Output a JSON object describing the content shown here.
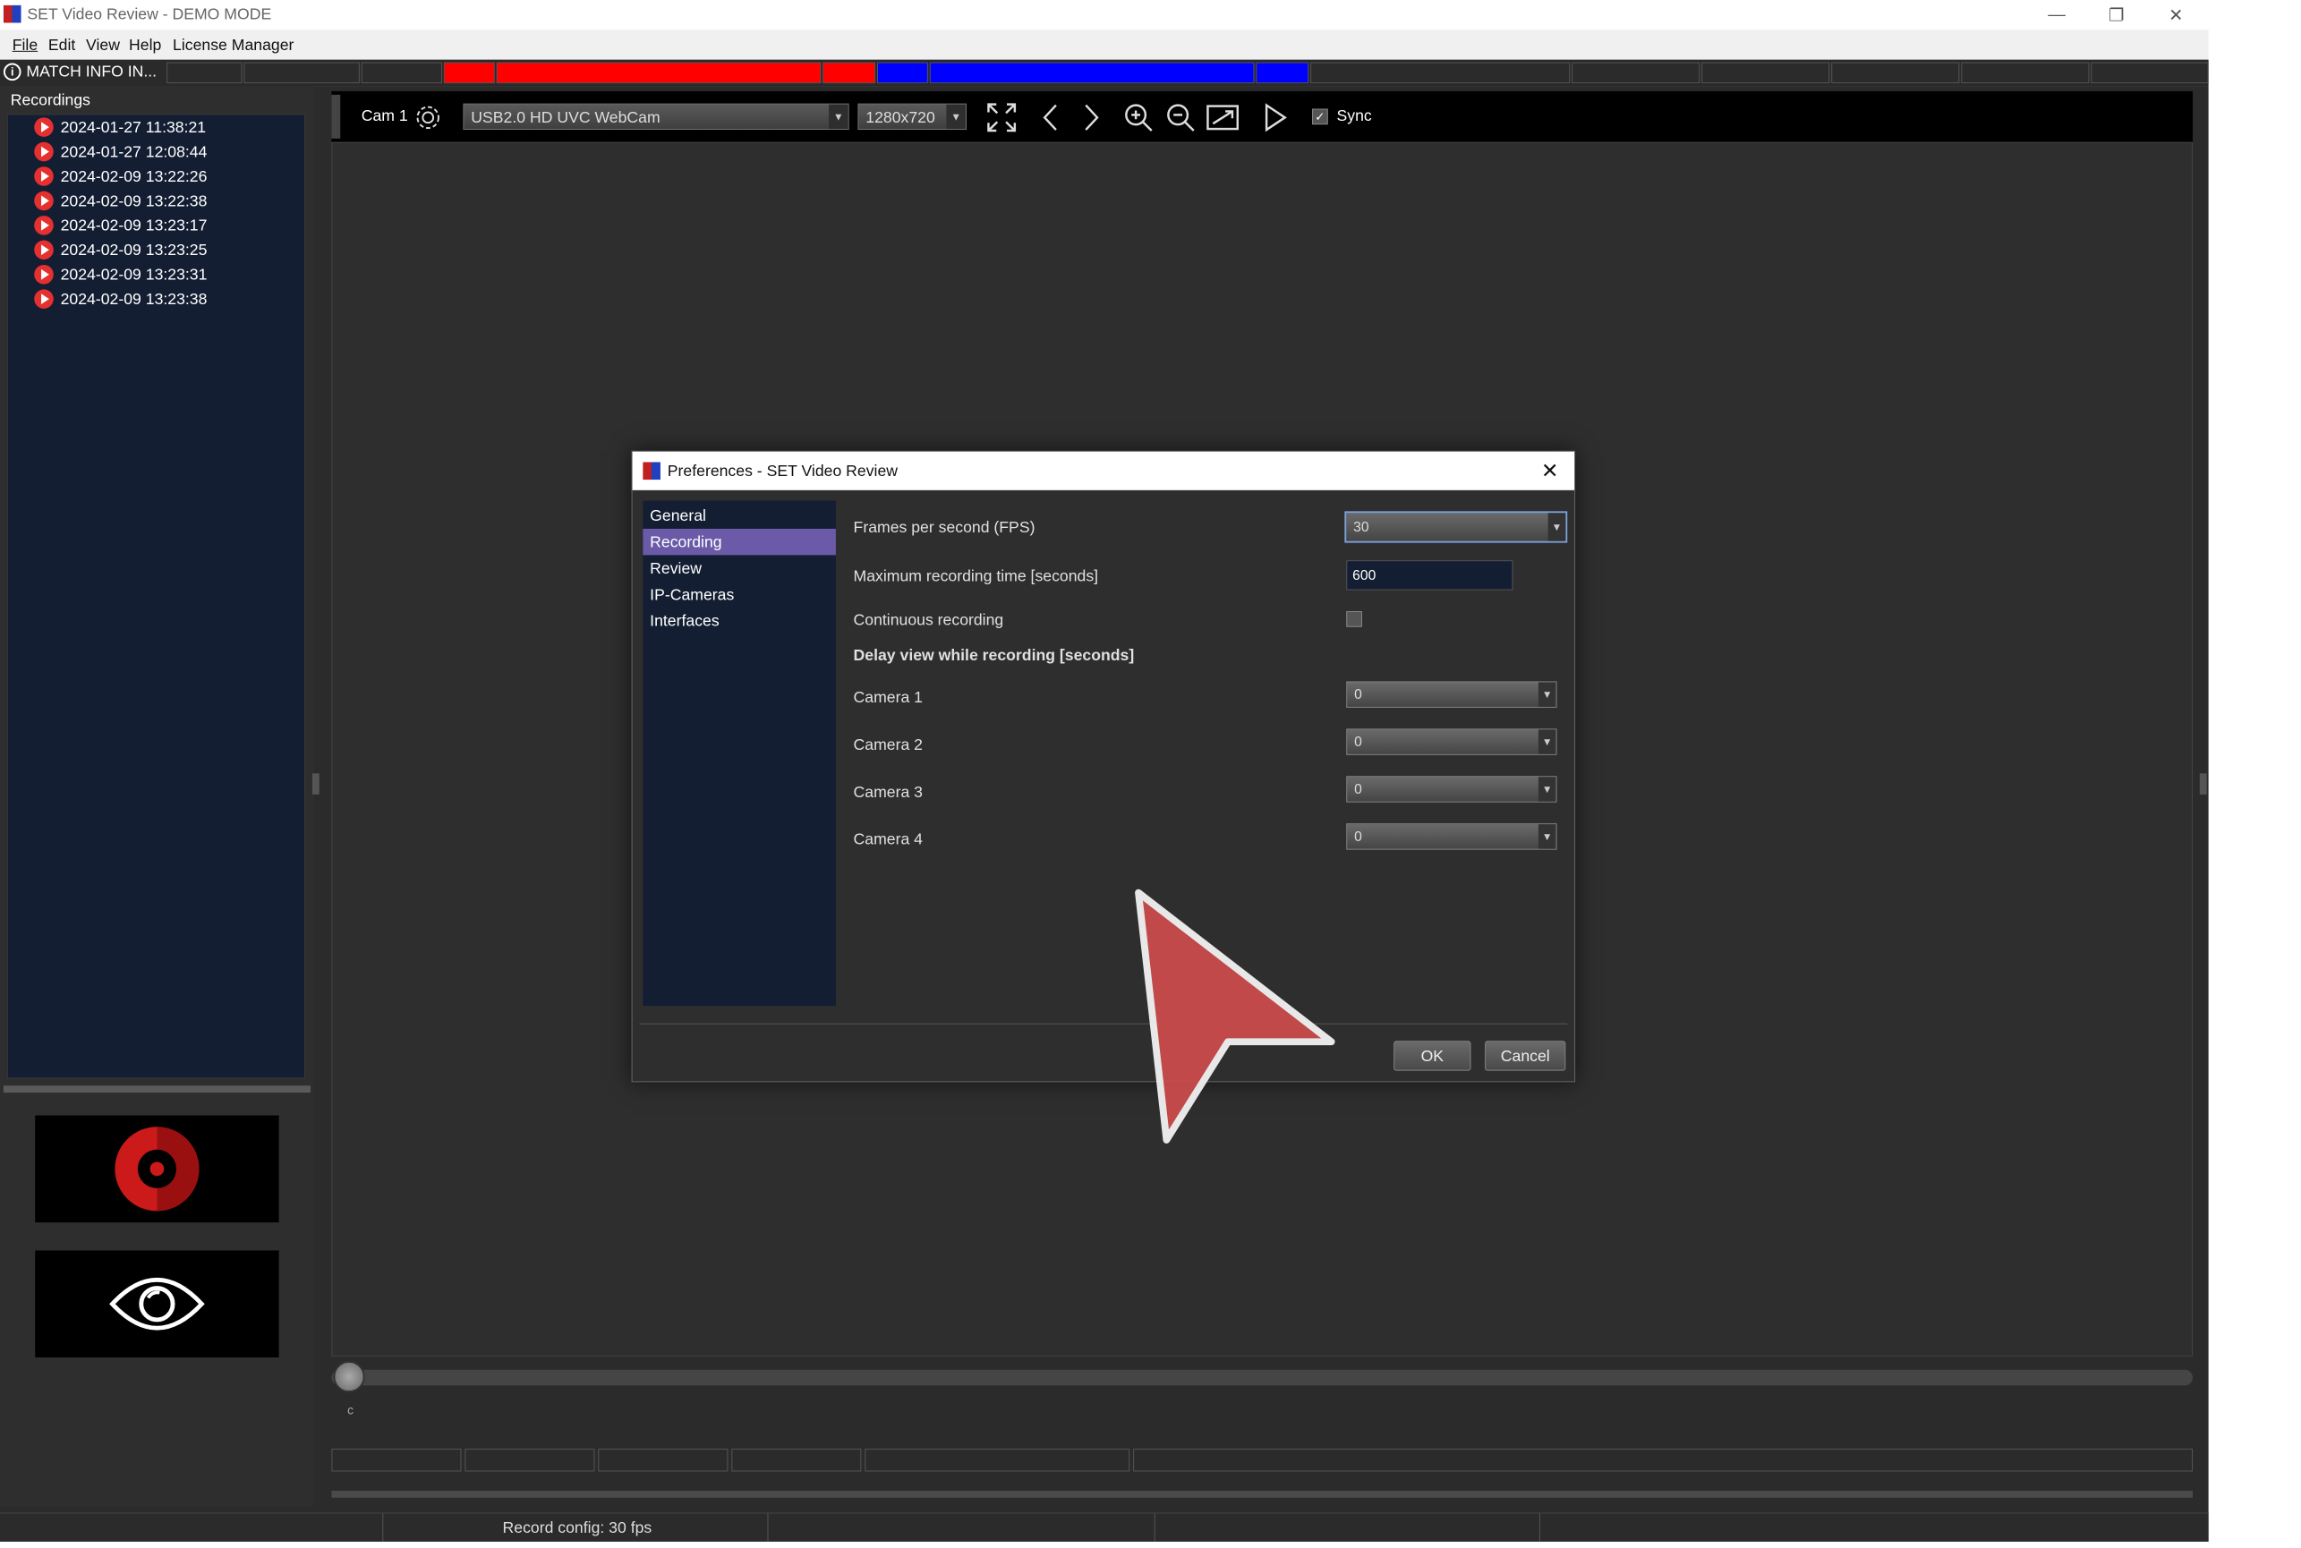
{
  "window": {
    "title": "SET Video Review - DEMO MODE",
    "minimize": "—",
    "restore": "❐",
    "close": "✕"
  },
  "menu": {
    "file": "File",
    "edit": "Edit",
    "view": "View",
    "help": "Help",
    "license": "License Manager"
  },
  "match_info": {
    "label": "MATCH INFO IN..."
  },
  "colors": {
    "red_team": "#ff0000",
    "blue_team": "#0000ff",
    "selected": "#6a5aa8",
    "list_bg": "#141e33"
  },
  "recordings": {
    "title": "Recordings",
    "items": [
      "2024-01-27 11:38:21",
      "2024-01-27 12:08:44",
      "2024-02-09 13:22:26",
      "2024-02-09 13:22:38",
      "2024-02-09 13:23:17",
      "2024-02-09 13:23:25",
      "2024-02-09 13:23:31",
      "2024-02-09 13:23:38"
    ]
  },
  "camera": {
    "label": "Cam 1",
    "device": "USB2.0 HD UVC WebCam",
    "resolution": "1280x720",
    "sync_label": "Sync",
    "sync_checked": true
  },
  "timeline": {
    "position_label": "c"
  },
  "status": {
    "record_config": "Record config: 30 fps"
  },
  "dialog": {
    "title": "Preferences - SET Video Review",
    "nav": [
      "General",
      "Recording",
      "Review",
      "IP-Cameras",
      "Interfaces"
    ],
    "selected_nav": "Recording",
    "fps_label": "Frames per second (FPS)",
    "fps_value": "30",
    "max_time_label": "Maximum recording time [seconds]",
    "max_time_value": "600",
    "continuous_label": "Continuous recording",
    "continuous_checked": false,
    "delay_heading": "Delay view while recording [seconds]",
    "cameras": [
      {
        "label": "Camera 1",
        "value": "0"
      },
      {
        "label": "Camera 2",
        "value": "0"
      },
      {
        "label": "Camera 3",
        "value": "0"
      },
      {
        "label": "Camera 4",
        "value": "0"
      }
    ],
    "ok": "OK",
    "cancel": "Cancel"
  }
}
